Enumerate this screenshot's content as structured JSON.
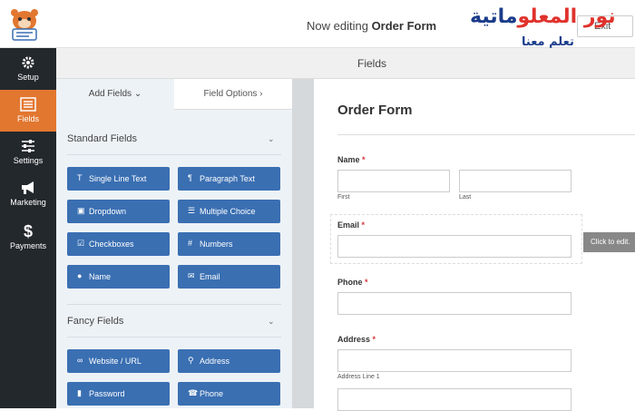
{
  "topbar": {
    "editing_prefix": "Now editing",
    "form_name": "Order Form",
    "watermark_line1_a": "نور المعلو",
    "watermark_line1_b": "ماتية",
    "watermark_line2": "تعلم معنا",
    "exit_label": "Exit"
  },
  "sidebar": {
    "items": [
      {
        "label": "Setup",
        "icon": "gear-icon"
      },
      {
        "label": "Fields",
        "icon": "list-icon",
        "active": true
      },
      {
        "label": "Settings",
        "icon": "sliders-icon"
      },
      {
        "label": "Marketing",
        "icon": "megaphone-icon"
      },
      {
        "label": "Payments",
        "icon": "dollar-icon"
      }
    ]
  },
  "header": {
    "title": "Fields"
  },
  "tabs": {
    "add_fields": "Add Fields",
    "field_options": "Field Options"
  },
  "standard_fields": {
    "title": "Standard Fields",
    "buttons": [
      {
        "label": "Single Line Text",
        "icon": "text-icon",
        "glyph": "T"
      },
      {
        "label": "Paragraph Text",
        "icon": "paragraph-icon",
        "glyph": "¶"
      },
      {
        "label": "Dropdown",
        "icon": "dropdown-icon",
        "glyph": "▣"
      },
      {
        "label": "Multiple Choice",
        "icon": "list-icon",
        "glyph": "☰"
      },
      {
        "label": "Checkboxes",
        "icon": "checkbox-icon",
        "glyph": "☑"
      },
      {
        "label": "Numbers",
        "icon": "hash-icon",
        "glyph": "#"
      },
      {
        "label": "Name",
        "icon": "user-icon",
        "glyph": "👤"
      },
      {
        "label": "Email",
        "icon": "envelope-icon",
        "glyph": "✉"
      }
    ]
  },
  "fancy_fields": {
    "title": "Fancy Fields",
    "buttons": [
      {
        "label": "Website / URL",
        "icon": "link-icon",
        "glyph": "🔗"
      },
      {
        "label": "Address",
        "icon": "map-pin-icon",
        "glyph": "📍"
      },
      {
        "label": "Password",
        "icon": "lock-icon",
        "glyph": "🔒"
      },
      {
        "label": "Phone",
        "icon": "phone-icon",
        "glyph": "☎"
      }
    ]
  },
  "form": {
    "title": "Order Form",
    "name_label": "Name",
    "name_first": "First",
    "name_last": "Last",
    "email_label": "Email",
    "click_to_edit": "Click to edit.",
    "phone_label": "Phone",
    "address_label": "Address",
    "address_line1": "Address Line 1",
    "required_mark": "*"
  }
}
